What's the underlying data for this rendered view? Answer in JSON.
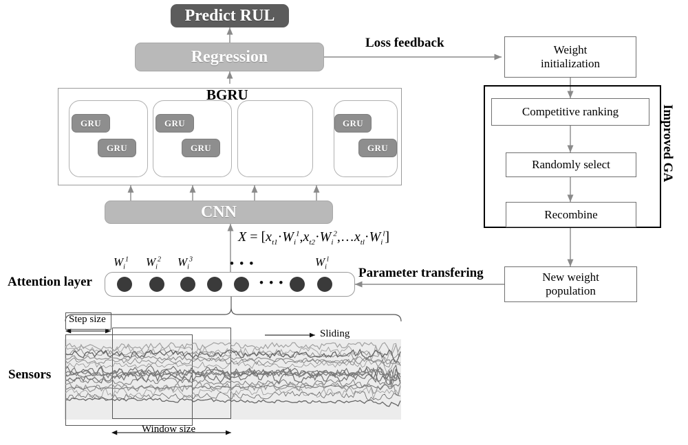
{
  "diagram": {
    "title": "Hybrid CNN-BGRU with attention and improved GA weight optimization framework"
  },
  "nodes": {
    "predict_rul": "Predict RUL",
    "regression": "Regression",
    "bgru": "BGRU",
    "cnn": "CNN",
    "gru": "GRU",
    "ellipsis": "• • •",
    "attention_layer": "Attention layer",
    "sensors": "Sensors",
    "weight_initialization": "Weight\ninitialization",
    "weight_initialization_l1": "Weight",
    "weight_initialization_l2": "initialization",
    "competitive_ranking": "Competitive ranking",
    "randomly_select": "Randomly select",
    "recombine": "Recombine",
    "new_weight_population_l1": "New  weight",
    "new_weight_population_l2": "population",
    "improved_ga": "Improved GA"
  },
  "edge_labels": {
    "loss_feedback": "Loss feedback",
    "parameter_transfering": "Parameter transfering"
  },
  "formula": {
    "text": "X = [x_t1 · W_i^1, x_t2 · W_i^2, ... x_tl · W_i^l]",
    "lhs": "X",
    "eq": "=",
    "open": "[",
    "close": "]",
    "terms": [
      {
        "x": "x",
        "xsub": "t1",
        "dot": "·",
        "w": "W",
        "wsub": "i",
        "wsup": "1",
        "sep": ","
      },
      {
        "x": "x",
        "xsub": "t2",
        "dot": "·",
        "w": "W",
        "wsub": "i",
        "wsup": "2",
        "sep": ","
      },
      {
        "x": "x",
        "xsub": "tl",
        "dot": "·",
        "w": "W",
        "wsub": "i",
        "wsup": "l",
        "sep": ""
      }
    ],
    "mid_ellipsis": "…"
  },
  "attention": {
    "weight_labels": [
      {
        "base": "W",
        "sub": "i",
        "sup": "1"
      },
      {
        "base": "W",
        "sub": "i",
        "sup": "2"
      },
      {
        "base": "W",
        "sub": "i",
        "sup": "3"
      },
      {
        "base": "W",
        "sub": "i",
        "sup": "l"
      }
    ],
    "ellipsis_top": "• • •",
    "ellipsis_inline": "• • •",
    "dot_count": 7
  },
  "sensors_panel": {
    "step_size": "Step size",
    "window_size": "Window size",
    "sliding": "Sliding"
  },
  "colors": {
    "dark_block": "#5c5c5c",
    "mid_block": "#b9b9b9",
    "gru_block": "#8e8e8e",
    "line_gray": "#8a8a8a",
    "line_black": "#000000",
    "band_gray": "#ececec",
    "dot_color": "#3a3a3a",
    "background": "#ffffff"
  }
}
